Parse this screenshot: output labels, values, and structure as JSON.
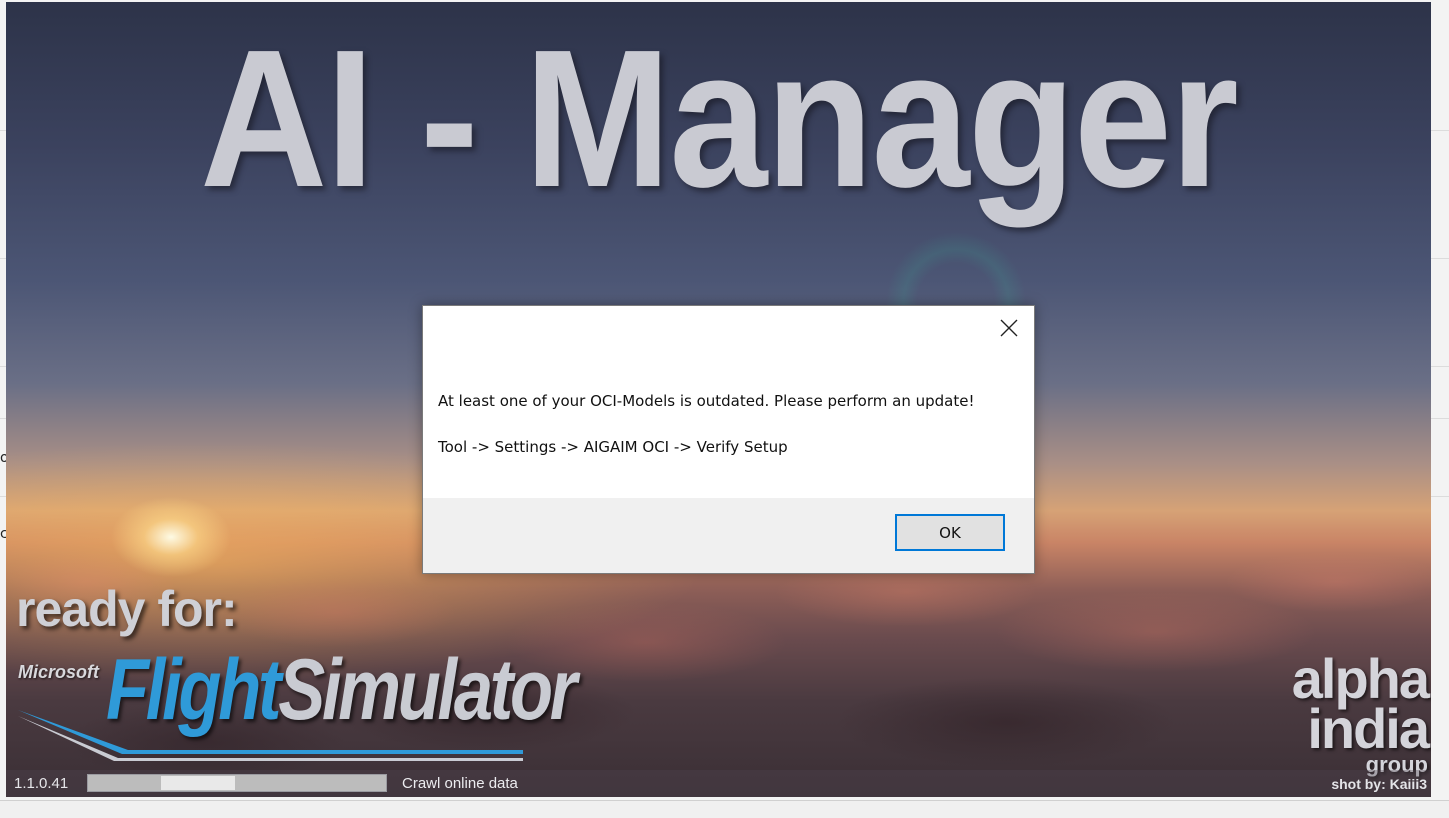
{
  "splash": {
    "title": "AI - Manager",
    "ready_for": "ready for:",
    "msfs_small": "Microsoft",
    "msfs_flight": "Flight",
    "msfs_simulator": "Simulator",
    "alpha_line1": "alpha",
    "alpha_line2": "india",
    "alpha_line3": "group"
  },
  "statusbar": {
    "version": "1.1.0.41",
    "task": "Crawl online data",
    "credit": "shot by: Kaiii3"
  },
  "dialog": {
    "message": "At least one of your OCI-Models is outdated. Please perform an update!",
    "path": "Tool -> Settings -> AIGAIM OCI -> Verify Setup",
    "ok_label": "OK",
    "close_icon": "close-icon"
  },
  "background": {
    "edge_text_1": "o",
    "edge_text_2": "c"
  },
  "colors": {
    "flight_blue": "#2f9ad8",
    "button_border": "#0078d7",
    "dialog_footer": "#f0f0f0"
  }
}
